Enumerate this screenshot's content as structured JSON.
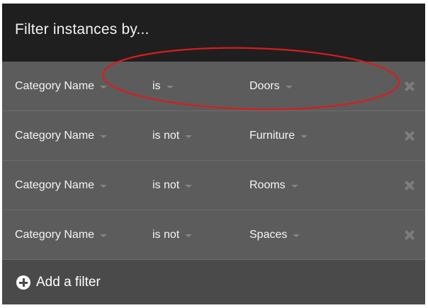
{
  "header": {
    "title": "Filter instances by..."
  },
  "filters": [
    {
      "field": "Category Name",
      "operator": "is",
      "value": "Doors"
    },
    {
      "field": "Category Name",
      "operator": "is not",
      "value": "Furniture"
    },
    {
      "field": "Category Name",
      "operator": "is not",
      "value": "Rooms"
    },
    {
      "field": "Category Name",
      "operator": "is not",
      "value": "Spaces"
    }
  ],
  "add_filter": {
    "label": "Add a filter",
    "icon": "plus-circle-icon"
  },
  "icons": {
    "remove": "close-icon",
    "dropdown": "caret-down-icon"
  },
  "colors": {
    "header_bg": "#1f1f1f",
    "panel_bg": "#5c5c5c",
    "footer_bg": "#4a4a4a",
    "annotation": "#d81d1d"
  }
}
